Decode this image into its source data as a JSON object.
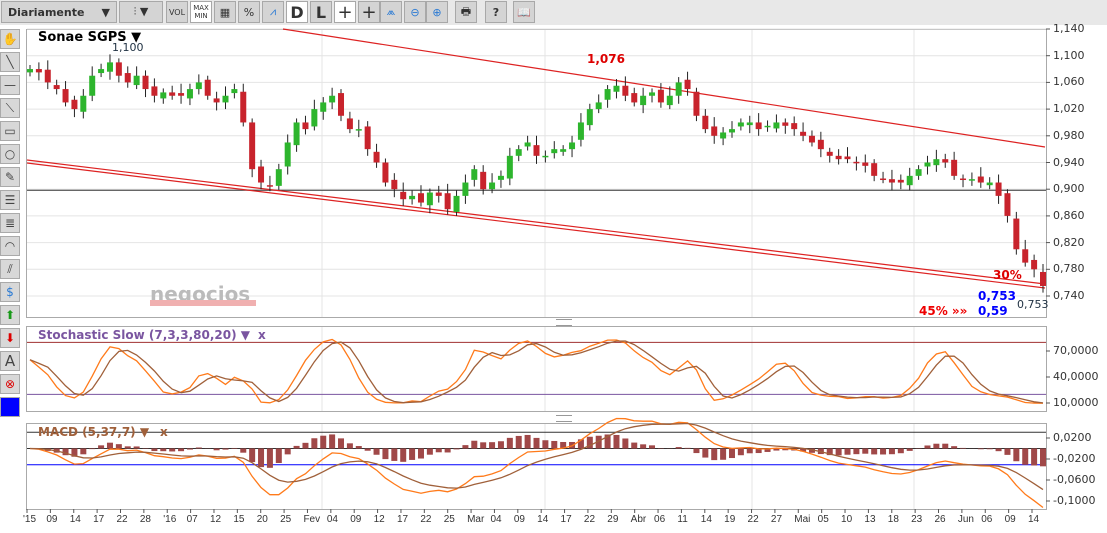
{
  "toolbar": {
    "period": "Diariamente",
    "vol": "VOL",
    "maxmin_1": "MAX",
    "maxmin_2": "MIN",
    "pct": "%",
    "d": "D",
    "l": "L",
    "print": "🖶",
    "help": "?"
  },
  "chart": {
    "title": "Sonae SGPS",
    "high_label": "1,100",
    "peak_label": "1,076",
    "pct30": "30%",
    "pct45": "45% »»",
    "val1": "0,753",
    "val2": "0,59",
    "last": "0,753",
    "watermark": "negocios"
  },
  "price_axis": [
    "1,140",
    "1,100",
    "1,060",
    "1,020",
    "0,980",
    "0,940",
    "0,900",
    "0,860",
    "0,820",
    "0,780",
    "0,740"
  ],
  "stoch": {
    "label": "Stochastic Slow (7,3,3,80,20)",
    "close": "x",
    "axis": [
      "70,0000",
      "40,0000",
      "10,0000"
    ]
  },
  "macd": {
    "label": "MACD (5,37,7)",
    "close": "x",
    "axis": [
      "0,0200",
      "-0,0200",
      "-0,0600",
      "-0,1000"
    ]
  },
  "dates": [
    "'15",
    "09",
    "14",
    "17",
    "22",
    "28",
    "'16",
    "07",
    "12",
    "15",
    "20",
    "25",
    "Fev",
    "04",
    "09",
    "12",
    "17",
    "22",
    "25",
    "Mar",
    "04",
    "09",
    "14",
    "17",
    "22",
    "29",
    "Abr",
    "06",
    "11",
    "14",
    "19",
    "22",
    "27",
    "Mai",
    "05",
    "10",
    "13",
    "18",
    "23",
    "26",
    "Jun",
    "06",
    "09",
    "14"
  ],
  "chart_data": {
    "type": "candlestick",
    "ylim": [
      0.72,
      1.14
    ],
    "closes": [
      1.08,
      1.075,
      1.06,
      1.05,
      1.03,
      1.02,
      1.04,
      1.07,
      1.08,
      1.09,
      1.07,
      1.06,
      1.07,
      1.05,
      1.04,
      1.045,
      1.04,
      1.04,
      1.05,
      1.06,
      1.04,
      1.03,
      1.04,
      1.05,
      1.0,
      0.93,
      0.91,
      0.905,
      0.93,
      0.97,
      1.0,
      0.99,
      1.02,
      1.03,
      1.04,
      1.01,
      0.99,
      0.99,
      0.96,
      0.94,
      0.91,
      0.9,
      0.885,
      0.89,
      0.88,
      0.895,
      0.89,
      0.87,
      0.89,
      0.91,
      0.93,
      0.9,
      0.91,
      0.92,
      0.95,
      0.96,
      0.97,
      0.95,
      0.95,
      0.96,
      0.96,
      0.97,
      1.0,
      1.02,
      1.03,
      1.05,
      1.055,
      1.04,
      1.03,
      1.04,
      1.045,
      1.03,
      1.04,
      1.06,
      1.05,
      1.01,
      0.99,
      0.98,
      0.985,
      0.99,
      1.0,
      1.0,
      0.99,
      0.995,
      1.0,
      0.995,
      0.99,
      0.98,
      0.97,
      0.96,
      0.95,
      0.945,
      0.945,
      0.94,
      0.935,
      0.92,
      0.915,
      0.91,
      0.91,
      0.92,
      0.93,
      0.94,
      0.945,
      0.94,
      0.92,
      0.915,
      0.915,
      0.91,
      0.91,
      0.89,
      0.86,
      0.81,
      0.79,
      0.78,
      0.755
    ]
  }
}
